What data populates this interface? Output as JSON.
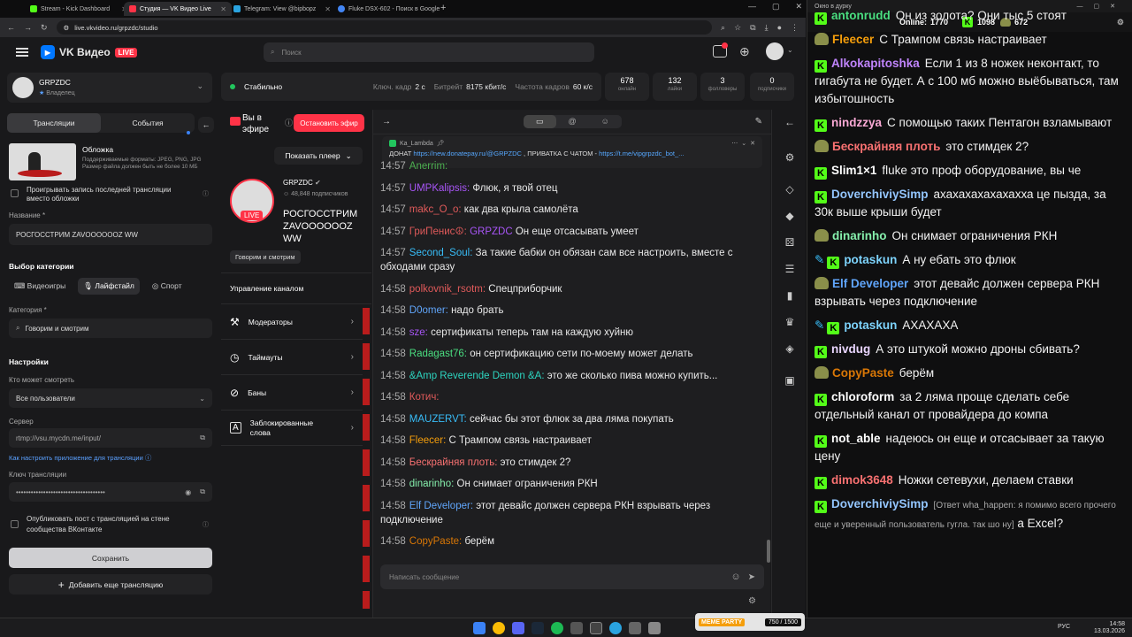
{
  "browser": {
    "tabs": [
      {
        "label": "Stream - Kick Dashboard",
        "color": "#53fc18"
      },
      {
        "label": "Студия — VK Видео Live",
        "color": "#ff3347"
      },
      {
        "label": "Telegram: View @bipbopz",
        "color": "#2aa3df"
      },
      {
        "label": "Fluke DSX-602 - Поиск в Google",
        "color": "#4285f4"
      }
    ],
    "url": "live.vkvideo.ru/grpzdc/studio"
  },
  "vk": {
    "logo_text": "VK Видео",
    "live_badge": "LIVE",
    "search_placeholder": "Поиск",
    "channel": {
      "name": "GRPZDC",
      "role": "Владелец"
    },
    "status": {
      "label": "Стабильно",
      "keyframe_label": "Ключ. кадр",
      "keyframe_value": "2 с",
      "bitrate_label": "Битрейт",
      "bitrate_value": "8175 кбит/с",
      "fps_label": "Частота кадров",
      "fps_value": "60 к/с"
    },
    "stats": [
      {
        "value": "678",
        "label": "онлайн"
      },
      {
        "value": "132",
        "label": "лайки"
      },
      {
        "value": "3",
        "label": "фолловеры"
      },
      {
        "value": "0",
        "label": "подписчики"
      }
    ],
    "left": {
      "tab_streams": "Трансляции",
      "tab_events": "События",
      "cover_title": "Обложка",
      "cover_desc": "Поддерживаемые форматы: JPEG, PNG, JPG Размер файла должен быть не более 10 МБ",
      "play_last_label": "Проигрывать запись последней трансляции вместо обложки",
      "name_label": "Название *",
      "name_value": "РОСГОССТРИМ ZAVOOOOOOZ WW",
      "category_choice_title": "Выбор категории",
      "cat_games": "Видеоигры",
      "cat_lifestyle": "Лайфстайл",
      "cat_sport": "Спорт",
      "category_label": "Категория *",
      "category_value": "Говорим и смотрим",
      "settings_title": "Настройки",
      "who_label": "Кто может смотреть",
      "who_value": "Все пользователи",
      "server_label": "Сервер",
      "server_value": "rtmp://vsu.mycdn.me/input/",
      "howto_link": "Как настроить приложение для трансляции",
      "key_label": "Ключ трансляции",
      "key_value": "••••••••••••••••••••••••••••••••••••",
      "publish_label": "Опубликовать пост с трансляцией на стене сообщества ВКонтакте",
      "save_button": "Сохранить",
      "add_button": "Добавить еще трансляцию"
    },
    "middle": {
      "on_air": "Вы в эфире",
      "stop_button": "Остановить эфир",
      "show_player": "Показать плеер",
      "channel_name": "GRPZDC",
      "subscribers": "48,848 подписчиков",
      "stream_title": "РОСГОССТРИМ ZAVOOOOOOZ WW",
      "category_chip": "Говорим и смотрим",
      "manage_title": "Управление каналом",
      "manage_items": [
        "Модераторы",
        "Таймауты",
        "Баны",
        "Заблокированные слова"
      ]
    },
    "chat": {
      "pinned_user": "Ka_Lambda",
      "pinned_prefix": "ДОНАТ",
      "pinned_link1": "https://new.donatepay.ru/@GRPZDC",
      "pinned_mid": ", ПРИВАТКА С ЧАТОМ -",
      "pinned_link2": "https://t.me/vipgrpzdc_bot_...",
      "input_placeholder": "Написать сообщение",
      "messages": [
        {
          "time": "14:57",
          "user": "Anerrim:",
          "color": "#4caf50",
          "text": ""
        },
        {
          "time": "14:57",
          "user": "UMPKalipsis:",
          "color": "#a855f7",
          "text": "Флюк, я твой отец"
        },
        {
          "time": "14:57",
          "user": "makc_O_o:",
          "color": "#e05a5a",
          "text": "как два крыла самолёта"
        },
        {
          "time": "14:57",
          "user": "ГриПенис☮:",
          "color": "#e05a5a",
          "text": "",
          "mention": "GRPZDC",
          "mention_color": "#a855f7",
          "after": "Он еще отсасывать умеет"
        },
        {
          "time": "14:57",
          "user": "Second_Soul:",
          "color": "#38bdf8",
          "text": "За такие бабки он обязан сам все настроить, вместе с обходами сразу"
        },
        {
          "time": "14:58",
          "user": "polkovnik_rsotm:",
          "color": "#e05a5a",
          "text": "Спецприборчик"
        },
        {
          "time": "14:58",
          "user": "D0omer:",
          "color": "#60a5fa",
          "text": "надо брать"
        },
        {
          "time": "14:58",
          "user": "sze:",
          "color": "#a855f7",
          "text": "сертификаты теперь там на каждую хуйню"
        },
        {
          "time": "14:58",
          "user": "Radagast76:",
          "color": "#4ade80",
          "text": "он сертификацию сети по-моему может делать"
        },
        {
          "time": "14:58",
          "user": "&Amp Reverende Demon &A:",
          "color": "#2dd4bf",
          "text": "это же сколько пива можно купить..."
        },
        {
          "time": "14:58",
          "user": "Котич:",
          "color": "#e05a5a",
          "text": ""
        },
        {
          "time": "14:58",
          "user": "MAUZERVT:",
          "color": "#38bdf8",
          "text": "сейчас бы этот флюк за два ляма покупать"
        },
        {
          "time": "14:58",
          "user": "Fleecer:",
          "color": "#f59e0b",
          "text": "С Трампом связь настраивает"
        },
        {
          "time": "14:58",
          "user": "Бескрайняя плоть:",
          "color": "#f87171",
          "text": "это стимдек 2?"
        },
        {
          "time": "14:58",
          "user": "dinarinho:",
          "color": "#86efac",
          "text": "Он снимает ограничения РКН"
        },
        {
          "time": "14:58",
          "user": "Elf Developer:",
          "color": "#60a5fa",
          "text": "этот девайс должен сервера РКН взрывать через подключение"
        },
        {
          "time": "14:58",
          "user": "CopyPaste:",
          "color": "#d97706",
          "text": "берём"
        }
      ]
    }
  },
  "kick": {
    "window_title": "Окно в дурку",
    "online_label": "Online:",
    "online_value": "1770",
    "followers": "1098",
    "subs": "672",
    "messages": [
      {
        "user": "antonrudd",
        "color": "#4ade80",
        "badge": "k",
        "text": "Он из золота? Они тыс 5 стоят"
      },
      {
        "user": "Fleecer",
        "color": "#f59e0b",
        "badge": "emo",
        "text": "С Трампом связь настраивает"
      },
      {
        "user": "Alkokapitoshka",
        "color": "#c084fc",
        "badge": "k",
        "text": "Если 1 из 8 ножек неконтакт, то гигабута не будет. А с 100 мб можно выёбываться, там избытошность"
      },
      {
        "user": "nindzzya",
        "color": "#f9a8d4",
        "badge": "k",
        "text": "С помощью таких Пентагон взламывают"
      },
      {
        "user": "Бескрайняя плоть",
        "color": "#f87171",
        "badge": "emo",
        "text": "это стимдек 2?"
      },
      {
        "user": "Slim1×1",
        "color": "#ffffff",
        "badge": "k",
        "text": "fluke это проф оборудование, вы че"
      },
      {
        "user": "DoverchiviySimp",
        "color": "#93c5fd",
        "badge": "k",
        "text": "ахахахахахахахха це пызда, за 30к выше крыши будет"
      },
      {
        "user": "dinarinho",
        "color": "#86efac",
        "badge": "emo",
        "text": "Он снимает ограничения РКН"
      },
      {
        "user": "potaskun",
        "color": "#7dd3fc",
        "badge": "k2",
        "text": "А ну ебать это флюк"
      },
      {
        "user": "Elf Developer",
        "color": "#60a5fa",
        "badge": "emo",
        "text": "этот девайс должен сервера РКН взрывать через подключение"
      },
      {
        "user": "potaskun",
        "color": "#7dd3fc",
        "badge": "k2",
        "text": "АХАХАХА"
      },
      {
        "user": "nivdug",
        "color": "#e9d5ff",
        "badge": "k",
        "text": "А это штукой можно дроны сбивать?"
      },
      {
        "user": "CopyPaste",
        "color": "#d97706",
        "badge": "emo",
        "text": "берём"
      },
      {
        "user": "chloroform",
        "color": "#ffffff",
        "badge": "k",
        "text": "за 2 ляма проще сделать себе отдельный канал от провайдера до компа"
      },
      {
        "user": "not_able",
        "color": "#ffffff",
        "badge": "k",
        "text": "надеюсь он еще и отсасывает за такую цену"
      },
      {
        "user": "dimok3648",
        "color": "#f87171",
        "badge": "k",
        "text": "Ножки сетевухи, делаем ставки"
      },
      {
        "user": "DoverchiviySimp",
        "color": "#93c5fd",
        "badge": "k",
        "reply": "[Ответ wha_happen: я помимо всего прочего еще и уверенный пользователь гугла. так шо ну]",
        "text": "а Excel?"
      }
    ]
  },
  "taskbar": {
    "lang": "РУС",
    "time": "14:58",
    "date": "13.03.2026",
    "party_label": "MEME PARTY",
    "party_progress": "750 / 1500"
  }
}
